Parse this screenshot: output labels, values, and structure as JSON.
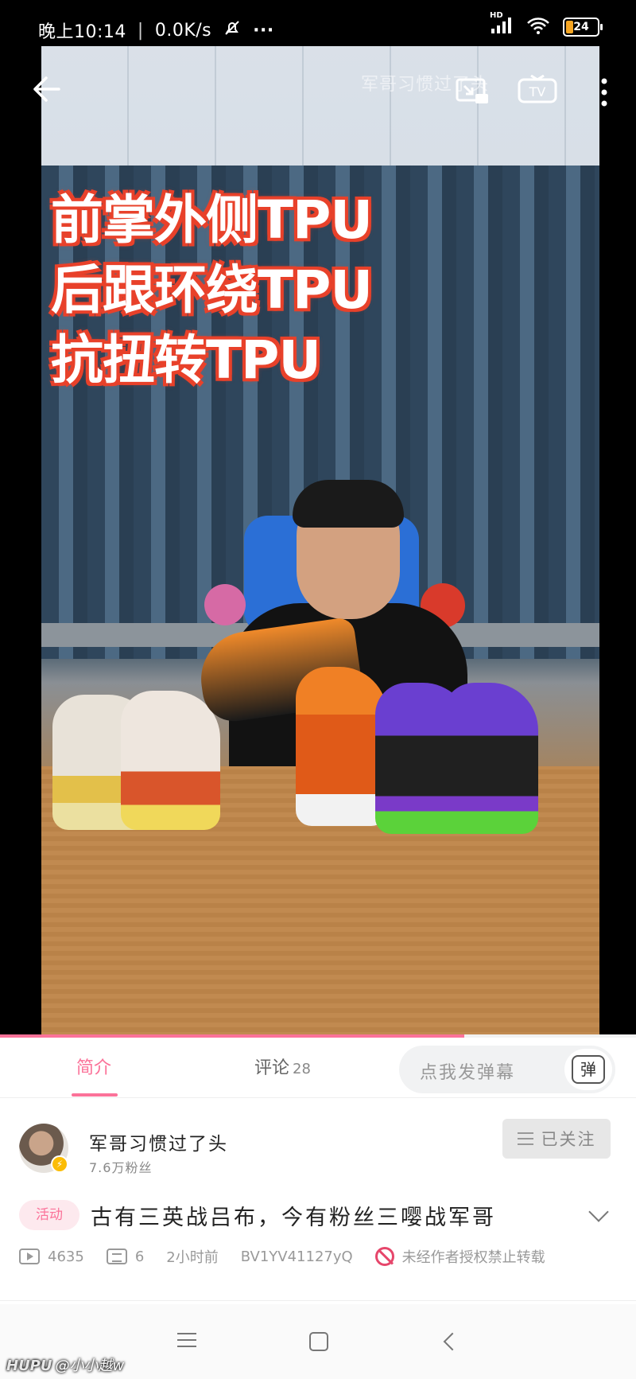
{
  "status_bar": {
    "time": "晚上10:14",
    "separator": "|",
    "net_speed": "0.0K/s",
    "more": "···",
    "signal_label": "HD",
    "battery": "24",
    "battery_level": 0.24,
    "icons": [
      "mute-bell-icon",
      "signal-icon",
      "wifi-icon",
      "battery-icon"
    ]
  },
  "video": {
    "watermark": "军哥习惯过了头",
    "overlay_lines": [
      "前掌外侧TPU",
      "后跟环绕TPU",
      "抗扭转TPU"
    ],
    "controls": [
      "back-arrow-icon",
      "cast-icon",
      "tv-icon",
      "more-vertical-icon"
    ],
    "tv_label": "TV",
    "progress": 0.73
  },
  "tabs": {
    "intro": "简介",
    "comments": "评论",
    "comments_count": "28",
    "danmaku_placeholder": "点我发弹幕",
    "danmaku_icon_label": "弹"
  },
  "uploader": {
    "name": "军哥习惯过了头",
    "fans": "7.6万粉丝",
    "follow_label": "已关注"
  },
  "video_info": {
    "tag": "活动",
    "title": "古有三英战吕布，今有粉丝三嘤战军哥",
    "views": "4635",
    "danmaku_count": "6",
    "time_ago": "2小时前",
    "bvid": "BV1YV41127yQ",
    "copyright": "未经作者授权禁止转载"
  },
  "watermark_bottom": {
    "brand": "HUPU",
    "user": "@小小越w"
  },
  "colors": {
    "accent": "#fb7299",
    "overlay_stroke": "#e8412a",
    "ban_red": "#e6466b"
  }
}
